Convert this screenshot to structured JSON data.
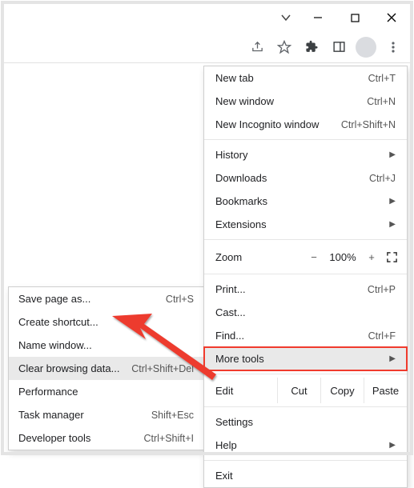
{
  "window": {
    "chevron": "⌄"
  },
  "menu": {
    "new_tab": "New tab",
    "new_tab_sc": "Ctrl+T",
    "new_window": "New window",
    "new_window_sc": "Ctrl+N",
    "new_incognito": "New Incognito window",
    "new_incognito_sc": "Ctrl+Shift+N",
    "history": "History",
    "downloads": "Downloads",
    "downloads_sc": "Ctrl+J",
    "bookmarks": "Bookmarks",
    "extensions": "Extensions",
    "zoom_label": "Zoom",
    "zoom_minus": "−",
    "zoom_value": "100%",
    "zoom_plus": "+",
    "print": "Print...",
    "print_sc": "Ctrl+P",
    "cast": "Cast...",
    "find": "Find...",
    "find_sc": "Ctrl+F",
    "more_tools": "More tools",
    "edit_label": "Edit",
    "cut": "Cut",
    "copy": "Copy",
    "paste": "Paste",
    "settings": "Settings",
    "help": "Help",
    "exit": "Exit",
    "arrow": "▶"
  },
  "submenu": {
    "save_page": "Save page as...",
    "save_page_sc": "Ctrl+S",
    "create_shortcut": "Create shortcut...",
    "name_window": "Name window...",
    "clear_browsing": "Clear browsing data...",
    "clear_browsing_sc": "Ctrl+Shift+Del",
    "performance": "Performance",
    "task_manager": "Task manager",
    "task_manager_sc": "Shift+Esc",
    "developer_tools": "Developer tools",
    "developer_tools_sc": "Ctrl+Shift+I"
  }
}
